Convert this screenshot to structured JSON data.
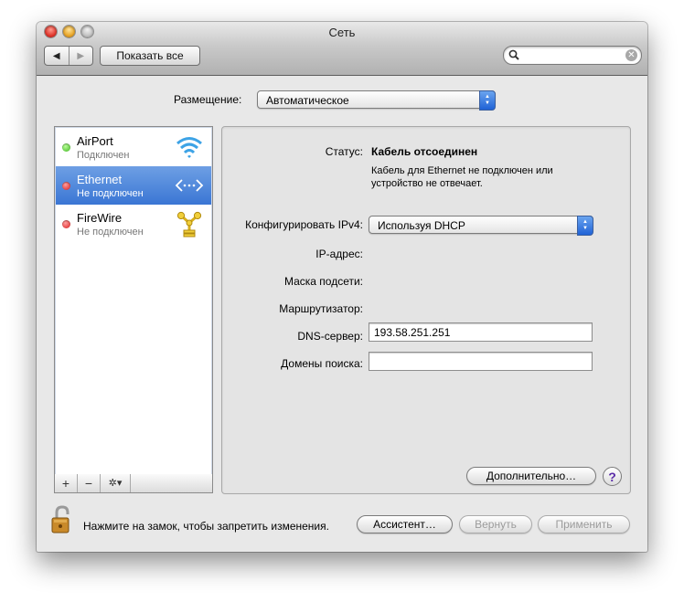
{
  "window": {
    "title": "Сеть"
  },
  "toolbar": {
    "back_symbol": "◀",
    "forward_symbol": "▶",
    "show_all_label": "Показать все",
    "search_value": "",
    "clear_symbol": "✕"
  },
  "location": {
    "label": "Размещение:",
    "value": "Автоматическое"
  },
  "services": [
    {
      "name": "AirPort",
      "status": "Подключен",
      "status_color": "#3db41d",
      "icon": "wifi-icon"
    },
    {
      "name": "Ethernet",
      "status": "Не подключен",
      "status_color": "#d81c1c",
      "icon": "ethernet-icon",
      "selected": true
    },
    {
      "name": "FireWire",
      "status": "Не подключен",
      "status_color": "#d81c1c",
      "icon": "firewire-icon"
    }
  ],
  "sidebar_controls": {
    "add": "+",
    "remove": "−",
    "action": "✲▾"
  },
  "detail": {
    "status_label": "Статус:",
    "status_value": "Кабель отсоединен",
    "status_desc_line1": "Кабель для Ethernet не подключен или",
    "status_desc_line2": "устройство не отвечает.",
    "ipv4_label": "Конфигурировать IPv4:",
    "ipv4_value": "Используя DHCP",
    "ip_label": "IP-адрес:",
    "mask_label": "Маска подсети:",
    "router_label": "Маршрутизатор:",
    "dns_label": "DNS-сервер:",
    "dns_value": "193.58.251.251",
    "search_domains_label": "Домены поиска:",
    "search_domains_value": "",
    "advanced_label": "Дополнительно…",
    "help_label": "?"
  },
  "footer": {
    "lock_text": "Нажмите на замок, чтобы запретить изменения.",
    "assist_label": "Ассистент…",
    "revert_label": "Вернуть",
    "apply_label": "Применить"
  },
  "colors": {
    "selection": "#3a76d4",
    "popup_arrows": "#1f62d6",
    "status_connected": "#3db41d",
    "status_disconnected": "#d81c1c"
  }
}
